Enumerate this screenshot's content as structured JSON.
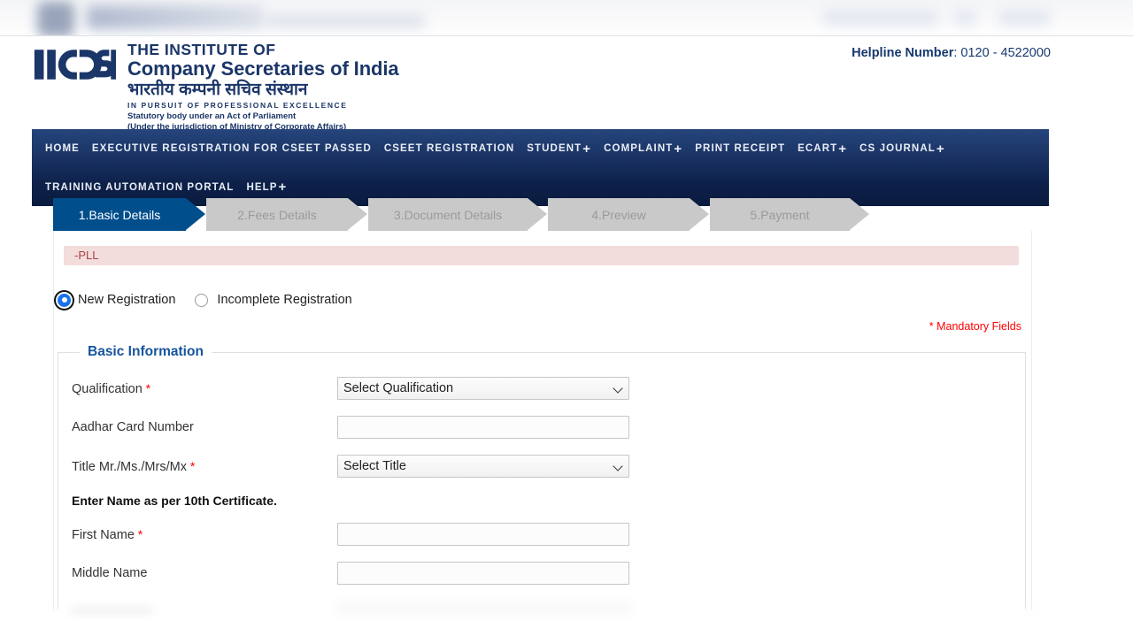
{
  "header": {
    "logo_alt": "ICSI",
    "title_line1": "THE INSTITUTE OF",
    "title_line2": "Company Secretaries of India",
    "title_hindi": "भारतीय कम्पनी सचिव संस्थान",
    "tagline": "IN PURSUIT OF PROFESSIONAL EXCELLENCE",
    "sub_line1": "Statutory body under an Act of Parliament",
    "sub_line2": "(Under the jurisdiction of Ministry of Corporate Affairs)",
    "helpline_label": "Helpline Number",
    "helpline_sep": ": ",
    "helpline_value": "0120 - 4522000"
  },
  "nav": {
    "row1": [
      {
        "label": "HOME",
        "has_plus": false
      },
      {
        "label": "EXECUTIVE REGISTRATION FOR CSEET PASSED",
        "has_plus": false
      },
      {
        "label": "CSEET REGISTRATION",
        "has_plus": false
      },
      {
        "label": "STUDENT",
        "has_plus": true
      },
      {
        "label": "COMPLAINT",
        "has_plus": true
      },
      {
        "label": "PRINT RECEIPT",
        "has_plus": false
      },
      {
        "label": "ECART",
        "has_plus": true
      },
      {
        "label": "CS JOURNAL",
        "has_plus": true
      }
    ],
    "row2": [
      {
        "label": "TRAINING AUTOMATION PORTAL",
        "has_plus": false
      },
      {
        "label": "HELP",
        "has_plus": true
      }
    ],
    "plus_glyph": "+"
  },
  "wizard": {
    "steps": [
      {
        "label": "1.Basic Details",
        "active": true
      },
      {
        "label": "2.Fees Details",
        "active": false
      },
      {
        "label": "3.Document Details",
        "active": false
      },
      {
        "label": "4.Preview",
        "active": false
      },
      {
        "label": "5.Payment",
        "active": false
      }
    ]
  },
  "alert": {
    "message": "-PLL"
  },
  "registration_type": {
    "options": [
      {
        "label": "New Registration",
        "selected": true
      },
      {
        "label": "Incomplete Registration",
        "selected": false
      }
    ]
  },
  "mandatory_note": "* Mandatory Fields",
  "basic_information": {
    "legend": "Basic Information",
    "note": "Enter Name as per 10th Certificate.",
    "fields": [
      {
        "label": "Qualification",
        "required": true,
        "type": "select",
        "value": "Select Qualification"
      },
      {
        "label": "Aadhar Card Number",
        "required": false,
        "type": "text",
        "value": "",
        "placeholder": ""
      },
      {
        "label": "Title Mr./Ms./Mrs/Mx",
        "required": true,
        "type": "select",
        "value": "Select Title"
      },
      {
        "label": "First Name",
        "required": true,
        "type": "text",
        "value": "",
        "placeholder": ""
      },
      {
        "label": "Middle Name",
        "required": false,
        "type": "text",
        "value": "",
        "placeholder": ""
      }
    ]
  },
  "colors": {
    "brand_navy": "#1b3668",
    "nav_gradient_top": "#26457c",
    "nav_gradient_bottom": "#0a1b3e",
    "step_active": "#004e8c",
    "step_inactive": "#c9c9c9",
    "alert_bg": "#f3dcdc",
    "alert_text": "#a94442",
    "required_red": "#ff0000",
    "legend_blue": "#16549e",
    "radio_checked": "#1a73e8"
  }
}
